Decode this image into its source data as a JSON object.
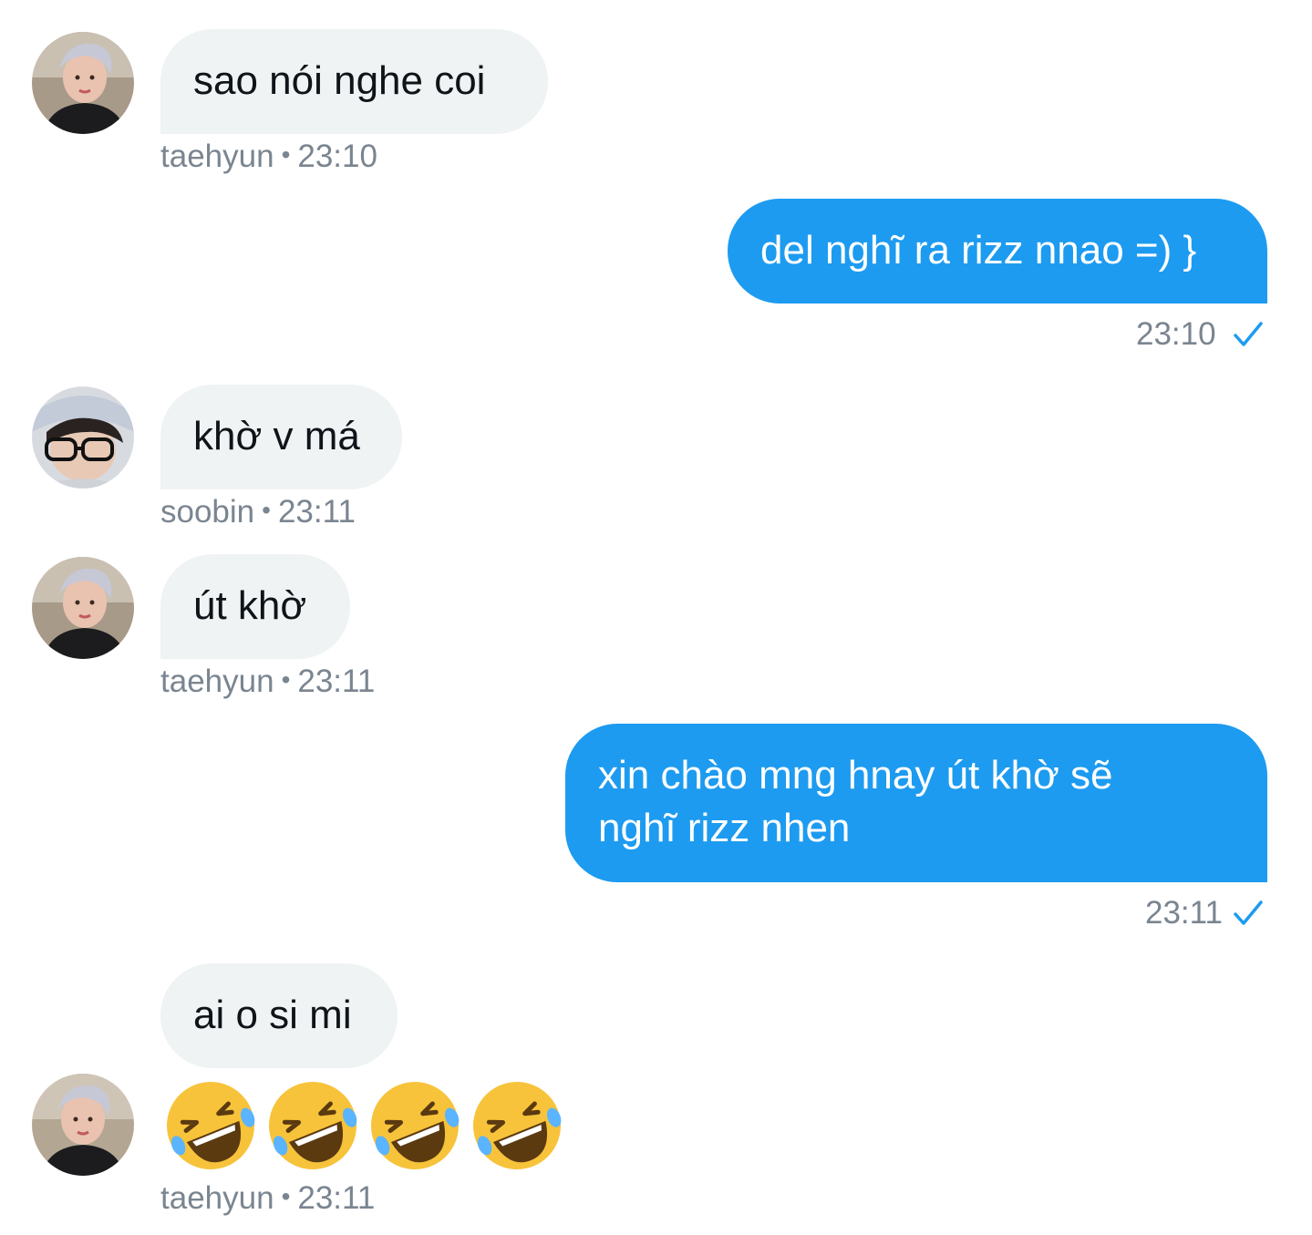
{
  "colors": {
    "accent": "#1d9bf0",
    "incoming_bubble": "#eff3f4",
    "meta_text": "#7a8590"
  },
  "messages": [
    {
      "sender": "taehyun",
      "time": "23:10",
      "text": "sao nói nghe coi",
      "avatar": "taehyun-avatar"
    },
    {
      "sender": "me",
      "time": "23:10",
      "text": "del nghĩ ra rizz nnao =) }"
    },
    {
      "sender": "soobin",
      "time": "23:11",
      "text": "khờ v má",
      "avatar": "soobin-avatar"
    },
    {
      "sender": "taehyun",
      "time": "23:11",
      "text": "út khờ",
      "avatar": "taehyun-avatar"
    },
    {
      "sender": "me",
      "time": "23:11",
      "text_line1": "xin chào mng hnay út khờ sẽ",
      "text_line2": "nghĩ rizz nhen"
    },
    {
      "sender": "taehyun",
      "time": "23:11",
      "text": "ai o si mi",
      "emoji": "🤣🤣🤣🤣",
      "emoji_icon": "rolling-on-floor-laughing-icon",
      "avatar": "taehyun-avatar"
    }
  ],
  "sent_icon": "checkmark-icon"
}
